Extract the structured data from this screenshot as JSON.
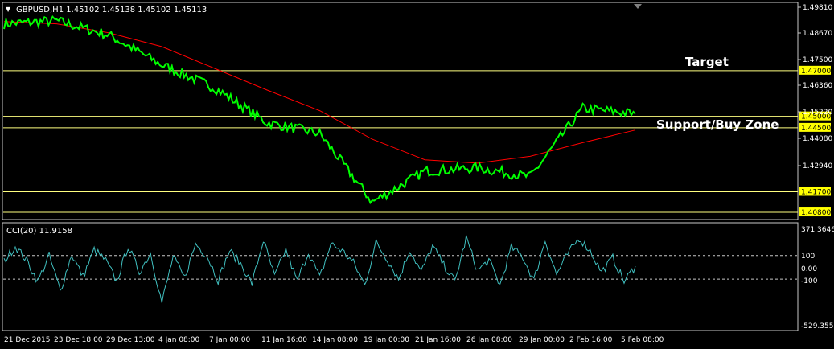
{
  "colors": {
    "background": "#000000",
    "frame": "#c8c8c8",
    "price": "#00ff00",
    "ma": "#ff0000",
    "hline": "#ffff80",
    "label_bg": "#ffff00",
    "cci": "#40c0c0",
    "text": "#ffffff",
    "cci_level": "#c8c8c8"
  },
  "header": {
    "triangle": "▼",
    "text": "GBPUSD,H1  1.45102 1.45138 1.45102 1.45113"
  },
  "annotations": {
    "target": "Target",
    "support": "Support/Buy Zone"
  },
  "price_axis": {
    "ticks": [
      "1.49810",
      "1.48670",
      "1.47500",
      "1.46360",
      "1.45220",
      "1.44080",
      "1.42940"
    ]
  },
  "hlines": [
    {
      "value": 1.47,
      "label": "1.47000"
    },
    {
      "value": 1.45,
      "label": "1.45000"
    },
    {
      "value": 1.445,
      "label": "1.44500"
    },
    {
      "value": 1.417,
      "label": "1.41700"
    },
    {
      "value": 1.408,
      "label": "1.40800"
    }
  ],
  "cci": {
    "title": "CCI(20) 11.9158",
    "axis_labels": [
      "371.3646",
      "100",
      "0.00",
      "-100",
      "-529.3557"
    ],
    "levels": [
      100,
      -100
    ]
  },
  "time_axis": {
    "labels": [
      "21 Dec 2015",
      "23 Dec 18:00",
      "29 Dec 13:00",
      "4 Jan 08:00",
      "7 Jan 00:00",
      "11 Jan 16:00",
      "14 Jan 08:00",
      "19 Jan 00:00",
      "21 Jan 16:00",
      "26 Jan 08:00",
      "29 Jan 00:00",
      "2 Feb 16:00",
      "5 Feb 08:00"
    ]
  },
  "chart_data": {
    "type": "line",
    "title": "GBPUSD,H1",
    "ylim": [
      1.4052,
      1.4995
    ],
    "x": [
      "21 Dec 2015",
      "23 Dec 18:00",
      "29 Dec 13:00",
      "4 Jan 08:00",
      "7 Jan 00:00",
      "11 Jan 16:00",
      "14 Jan 08:00",
      "19 Jan 00:00",
      "21 Jan 16:00",
      "26 Jan 08:00",
      "29 Jan 00:00",
      "2 Feb 16:00",
      "5 Feb 08:00"
    ],
    "series": [
      {
        "name": "GBPUSD,H1",
        "values": [
          1.4905,
          1.4918,
          1.4855,
          1.4725,
          1.4625,
          1.4472,
          1.4425,
          1.4125,
          1.426,
          1.4275,
          1.4235,
          1.4535,
          1.4511
        ]
      },
      {
        "values": [
          1.4915,
          1.4905,
          1.4865,
          1.4805,
          1.471,
          1.4615,
          1.4525,
          1.44,
          1.431,
          1.4295,
          1.4325,
          1.4385,
          1.444
        ]
      }
    ],
    "cci": {
      "name": "CCI(20)",
      "ylim": [
        -529.3557,
        371.3646
      ],
      "values": [
        50,
        180,
        60,
        -120,
        100,
        -200,
        110,
        -80,
        150,
        60,
        -120,
        180,
        -40,
        120,
        -300,
        90,
        -90,
        200,
        100,
        -110,
        140,
        30,
        -140,
        230,
        -80,
        150,
        -120,
        130,
        -90,
        200,
        140,
        40,
        -150,
        210,
        70,
        -100,
        150,
        -40,
        180,
        20,
        -120,
        250,
        -30,
        60,
        -150,
        170,
        90,
        -110,
        230,
        -60,
        110,
        250,
        140,
        -40,
        80,
        -120,
        10
      ]
    }
  }
}
